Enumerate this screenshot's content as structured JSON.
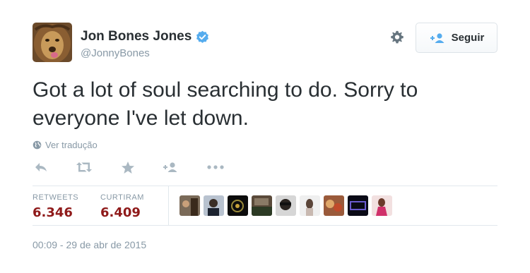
{
  "user": {
    "name": "Jon Bones Jones",
    "handle": "@JonnyBones",
    "verified": true
  },
  "follow_button": {
    "label": "Seguir",
    "icon": "add-user-icon"
  },
  "tweet": {
    "text": "Got a lot of soul searching to do. Sorry to everyone I've let down."
  },
  "translate_link": "Ver tradução",
  "actions": [
    "reply-icon",
    "retweet-icon",
    "favorite-icon",
    "follow-icon",
    "more-icon"
  ],
  "stats": {
    "retweets_label": "RETWEETS",
    "retweets_value": "6.346",
    "likes_label": "CURTIRAM",
    "likes_value": "6.409"
  },
  "favoriters_count_shown": 9,
  "timestamp": "00:09 - 29 de abr de 2015",
  "colors": {
    "text": "#292f33",
    "muted": "#8899a6",
    "stat_value": "#8f1a1a",
    "verified": "#55acee",
    "border": "#e1e8ed"
  }
}
